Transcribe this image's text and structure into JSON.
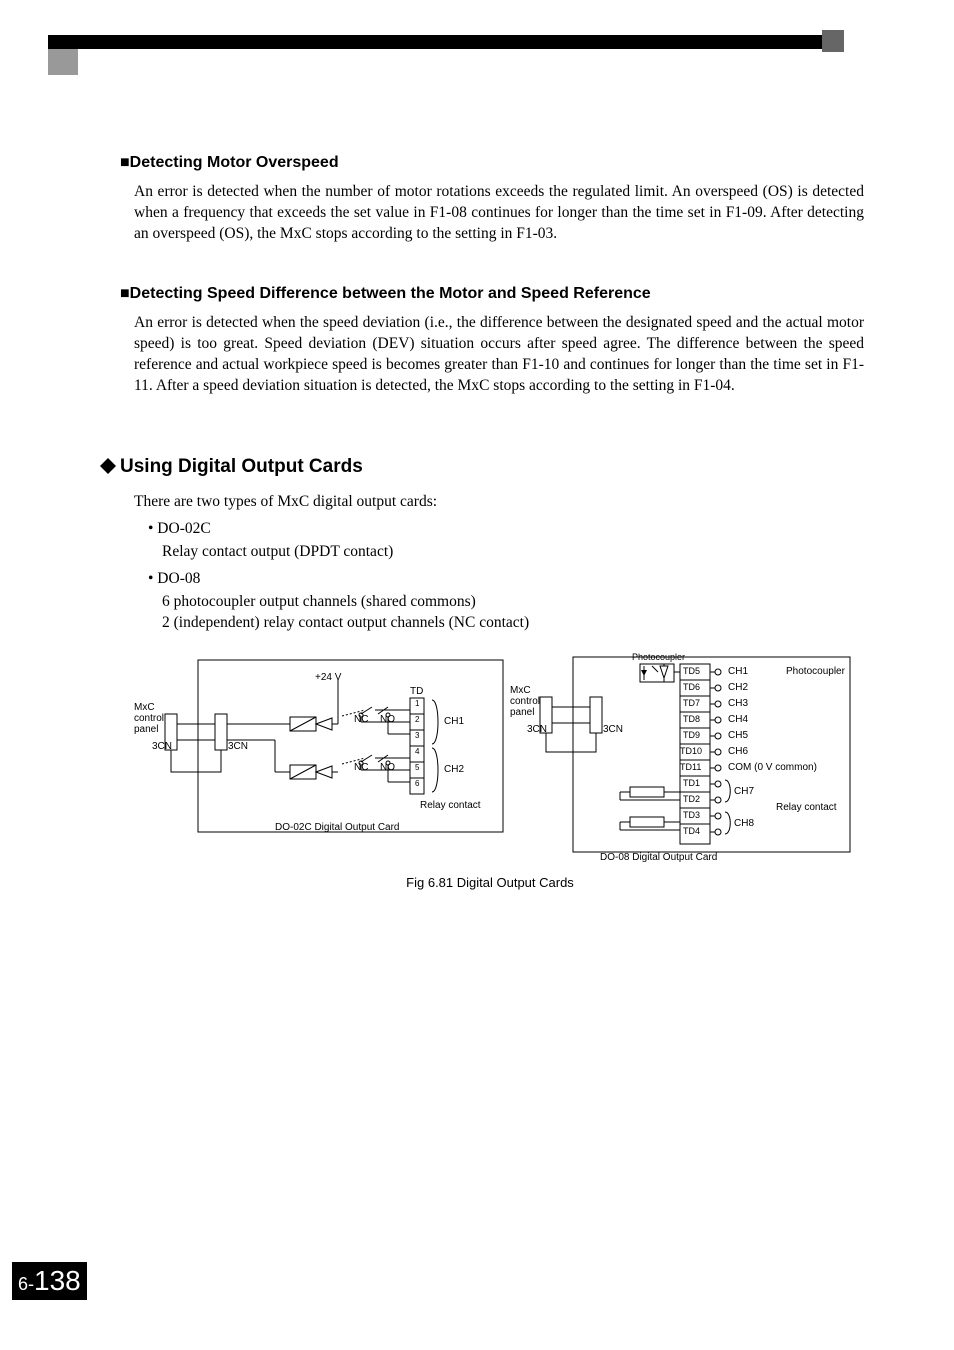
{
  "sub1": {
    "title": "■Detecting Motor Overspeed",
    "body": "An error is detected when the number of motor rotations exceeds the regulated limit. An overspeed (OS) is detected when a frequency that exceeds the set value in F1-08 continues for longer than the time set in F1-09. After detecting an overspeed (OS), the MxC stops according to the setting in F1-03."
  },
  "sub2": {
    "title": "■Detecting Speed Difference between the Motor and Speed Reference",
    "body": "An error is detected when the speed deviation (i.e., the difference between the designated speed and the actual motor speed) is too great. Speed deviation (DEV) situation occurs after speed agree. The difference between the speed reference and actual workpiece speed is becomes greater than F1-10 and continues for longer than the time set in F1-11. After a speed deviation situation is detected, the MxC stops according to the setting in F1-04."
  },
  "section": {
    "title": "Using Digital Output Cards",
    "intro": "There are two types of MxC digital output cards:",
    "items": [
      {
        "bullet": "• DO-02C",
        "sub": [
          "Relay contact output (DPDT contact)"
        ]
      },
      {
        "bullet": "• DO-08",
        "sub": [
          "6 photocoupler output channels (shared commons)",
          "2 (independent) relay contact output channels (NC contact)"
        ]
      }
    ]
  },
  "figure": {
    "caption": "Fig 6.81   Digital Output Cards",
    "left": {
      "panel": "MxC control panel",
      "conn1": "3CN",
      "conn2": "3CN",
      "volt": "+24 V",
      "td": "TD",
      "nc": "NC",
      "no": "NO",
      "t1": "1",
      "t2": "2",
      "t3": "3",
      "t4": "4",
      "t5": "5",
      "t6": "6",
      "ch1": "CH1",
      "ch2": "CH2",
      "relay": "Relay contact",
      "card": "DO-02C Digital Output Card"
    },
    "right": {
      "panel": "MxC control panel",
      "conn1": "3CN",
      "conn2": "3CN",
      "photo_lbl": "Photocoupler",
      "photo_lbl2": "Photocoupler",
      "td5": "TD5",
      "td6": "TD6",
      "td7": "TD7",
      "td8": "TD8",
      "td9": "TD9",
      "td10": "TD10",
      "td11": "TD11",
      "td1": "TD1",
      "td2": "TD2",
      "td3": "TD3",
      "td4": "TD4",
      "ch1": "CH1",
      "ch2": "CH2",
      "ch3": "CH3",
      "ch4": "CH4",
      "ch5": "CH5",
      "ch6": "CH6",
      "com": "COM (0 V common)",
      "ch7": "CH7",
      "ch8": "CH8",
      "relay": "Relay contact",
      "card": "DO-08 Digital Output Card"
    }
  },
  "page": {
    "prefix": "6-",
    "num": "138"
  }
}
